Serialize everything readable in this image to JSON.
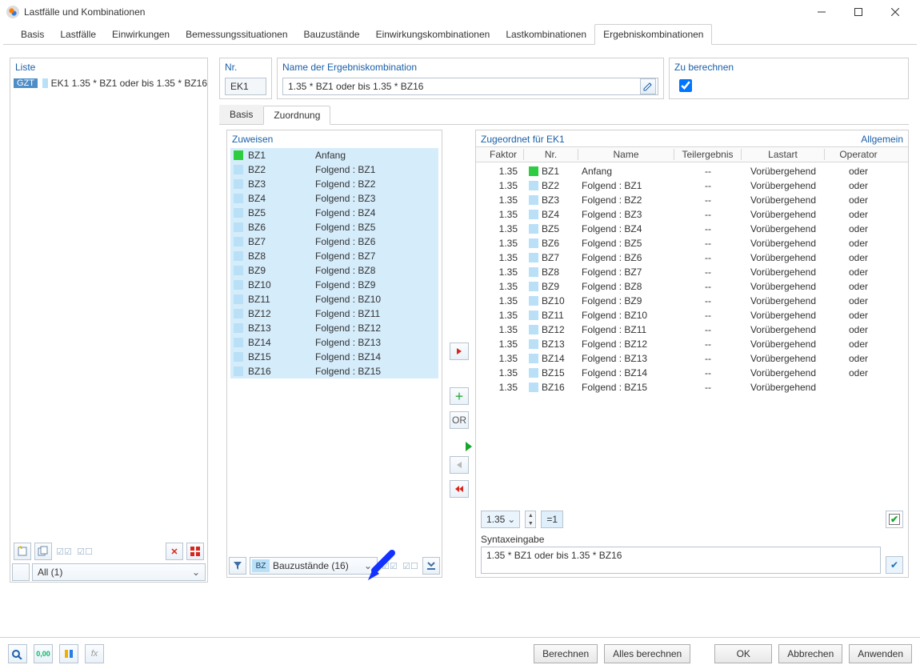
{
  "window": {
    "title": "Lastfälle und Kombinationen"
  },
  "mainTabs": {
    "items": [
      "Basis",
      "Lastfälle",
      "Einwirkungen",
      "Bemessungssituationen",
      "Bauzustände",
      "Einwirkungskombinationen",
      "Lastkombinationen",
      "Ergebniskombinationen"
    ],
    "activeIndex": 7
  },
  "liste": {
    "title": "Liste",
    "tag": "GZT",
    "code": "EK1",
    "text": "1.35 * BZ1 oder bis 1.35 * BZ16",
    "filterAll": "All (1)"
  },
  "nr": {
    "title": "Nr.",
    "value": "EK1"
  },
  "name": {
    "title": "Name der Ergebniskombination",
    "value": "1.35 * BZ1 oder bis 1.35 * BZ16"
  },
  "calc": {
    "title": "Zu berechnen",
    "checked": true
  },
  "subTabs": {
    "items": [
      "Basis",
      "Zuordnung"
    ],
    "activeIndex": 1
  },
  "zuweisen": {
    "title": "Zuweisen",
    "rows": [
      {
        "nr": "BZ1",
        "name": "Anfang",
        "first": true
      },
      {
        "nr": "BZ2",
        "name": "Folgend : BZ1"
      },
      {
        "nr": "BZ3",
        "name": "Folgend : BZ2"
      },
      {
        "nr": "BZ4",
        "name": "Folgend : BZ3"
      },
      {
        "nr": "BZ5",
        "name": "Folgend : BZ4"
      },
      {
        "nr": "BZ6",
        "name": "Folgend : BZ5"
      },
      {
        "nr": "BZ7",
        "name": "Folgend : BZ6"
      },
      {
        "nr": "BZ8",
        "name": "Folgend : BZ7"
      },
      {
        "nr": "BZ9",
        "name": "Folgend : BZ8"
      },
      {
        "nr": "BZ10",
        "name": "Folgend : BZ9"
      },
      {
        "nr": "BZ11",
        "name": "Folgend : BZ10"
      },
      {
        "nr": "BZ12",
        "name": "Folgend : BZ11"
      },
      {
        "nr": "BZ13",
        "name": "Folgend : BZ12"
      },
      {
        "nr": "BZ14",
        "name": "Folgend : BZ13"
      },
      {
        "nr": "BZ15",
        "name": "Folgend : BZ14"
      },
      {
        "nr": "BZ16",
        "name": "Folgend : BZ15"
      }
    ],
    "dropdownTag": "BZ",
    "dropdown": "Bauzustände (16)"
  },
  "xfer": {
    "or": "OR"
  },
  "zugeordnet": {
    "titleLeft": "Zugeordnet für EK1",
    "titleRight": "Allgemein",
    "headers": {
      "faktor": "Faktor",
      "nr": "Nr.",
      "name": "Name",
      "teil": "Teilergebnis",
      "lastart": "Lastart",
      "op": "Operator"
    },
    "rows": [
      {
        "f": "1.35",
        "nr": "BZ1",
        "name": "Anfang",
        "te": "--",
        "la": "Vorübergehend",
        "op": "oder",
        "first": true
      },
      {
        "f": "1.35",
        "nr": "BZ2",
        "name": "Folgend : BZ1",
        "te": "--",
        "la": "Vorübergehend",
        "op": "oder"
      },
      {
        "f": "1.35",
        "nr": "BZ3",
        "name": "Folgend : BZ2",
        "te": "--",
        "la": "Vorübergehend",
        "op": "oder"
      },
      {
        "f": "1.35",
        "nr": "BZ4",
        "name": "Folgend : BZ3",
        "te": "--",
        "la": "Vorübergehend",
        "op": "oder"
      },
      {
        "f": "1.35",
        "nr": "BZ5",
        "name": "Folgend : BZ4",
        "te": "--",
        "la": "Vorübergehend",
        "op": "oder"
      },
      {
        "f": "1.35",
        "nr": "BZ6",
        "name": "Folgend : BZ5",
        "te": "--",
        "la": "Vorübergehend",
        "op": "oder"
      },
      {
        "f": "1.35",
        "nr": "BZ7",
        "name": "Folgend : BZ6",
        "te": "--",
        "la": "Vorübergehend",
        "op": "oder"
      },
      {
        "f": "1.35",
        "nr": "BZ8",
        "name": "Folgend : BZ7",
        "te": "--",
        "la": "Vorübergehend",
        "op": "oder"
      },
      {
        "f": "1.35",
        "nr": "BZ9",
        "name": "Folgend : BZ8",
        "te": "--",
        "la": "Vorübergehend",
        "op": "oder"
      },
      {
        "f": "1.35",
        "nr": "BZ10",
        "name": "Folgend : BZ9",
        "te": "--",
        "la": "Vorübergehend",
        "op": "oder"
      },
      {
        "f": "1.35",
        "nr": "BZ11",
        "name": "Folgend : BZ10",
        "te": "--",
        "la": "Vorübergehend",
        "op": "oder"
      },
      {
        "f": "1.35",
        "nr": "BZ12",
        "name": "Folgend : BZ11",
        "te": "--",
        "la": "Vorübergehend",
        "op": "oder"
      },
      {
        "f": "1.35",
        "nr": "BZ13",
        "name": "Folgend : BZ12",
        "te": "--",
        "la": "Vorübergehend",
        "op": "oder"
      },
      {
        "f": "1.35",
        "nr": "BZ14",
        "name": "Folgend : BZ13",
        "te": "--",
        "la": "Vorübergehend",
        "op": "oder"
      },
      {
        "f": "1.35",
        "nr": "BZ15",
        "name": "Folgend : BZ14",
        "te": "--",
        "la": "Vorübergehend",
        "op": "oder"
      },
      {
        "f": "1.35",
        "nr": "BZ16",
        "name": "Folgend : BZ15",
        "te": "--",
        "la": "Vorübergehend",
        "op": ""
      }
    ],
    "factor": "1.35",
    "eq": "=1",
    "syntaxLabel": "Syntaxeingabe",
    "syntax": "1.35 * BZ1 oder bis 1.35 * BZ16"
  },
  "footer": {
    "berechnen": "Berechnen",
    "alles": "Alles berechnen",
    "ok": "OK",
    "abbrechen": "Abbrechen",
    "anwenden": "Anwenden"
  }
}
